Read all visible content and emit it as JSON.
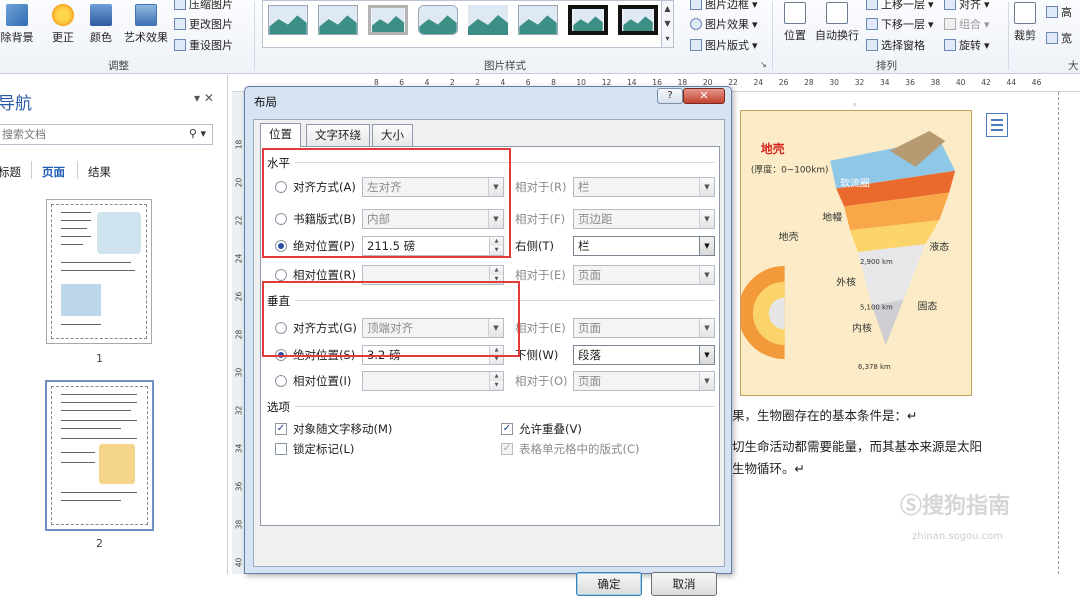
{
  "ribbon": {
    "adjust": {
      "remove_bg": "除背景",
      "corrections": "更正",
      "color": "颜色",
      "artistic": "艺术效果",
      "compress": "压缩图片",
      "change": "更改图片",
      "reset": "重设图片",
      "group_label": "调整"
    },
    "styles": {
      "group_label": "图片样式",
      "border": "图片边框",
      "effects": "图片效果",
      "layout": "图片版式"
    },
    "arrange": {
      "position": "位置",
      "wrap": "自动换行",
      "bring_forward": "上移一层",
      "send_backward": "下移一层",
      "selection_pane": "选择窗格",
      "align": "对齐",
      "group": "组合",
      "rotate": "旋转",
      "group_label": "排列"
    },
    "size": {
      "crop": "裁剪",
      "height": "高",
      "width": "宽",
      "group_label": "大"
    }
  },
  "nav": {
    "title": "导航",
    "search_placeholder": "搜索文档",
    "tabs": [
      "标题",
      "页面",
      "结果"
    ],
    "pages": [
      "1",
      "2"
    ]
  },
  "ruler": {
    "h": [
      "8",
      "6",
      "4",
      "2",
      "2",
      "4",
      "6",
      "8",
      "10",
      "12",
      "14",
      "16",
      "18",
      "20",
      "22",
      "24",
      "26",
      "28",
      "30",
      "32",
      "34",
      "36",
      "38",
      "40",
      "42",
      "44",
      "46"
    ],
    "v": [
      "18",
      "20",
      "22",
      "24",
      "26",
      "28",
      "30",
      "32",
      "34",
      "36",
      "38",
      "40"
    ]
  },
  "doc": {
    "line1": "果，生物圈存在的基本条件是：↵",
    "line2": "切生命活动都需要能量，而其基本来源是太阳",
    "line3": "生物循环。↵",
    "figure": {
      "crust_title": "地壳",
      "crust_thickness": "(厚度：0~100km)",
      "asthenosphere": "软流圈",
      "mantle": "地幔",
      "crust": "地壳",
      "outer_core": "外核",
      "liquid": "液态",
      "inner_core": "内核",
      "solid": "固态",
      "d1": "2,900 km",
      "d2": "5,100 km",
      "d3": "6,378 km"
    }
  },
  "dialog": {
    "title": "布局",
    "help": "?",
    "close": "✕",
    "tabs": [
      "位置",
      "文字环绕",
      "大小"
    ],
    "horizontal": {
      "title": "水平",
      "rows": [
        {
          "label": "对齐方式(A)",
          "value": "左对齐",
          "rel_label": "相对于(R)",
          "rel_value": "栏"
        },
        {
          "label": "书籍版式(B)",
          "value": "内部",
          "rel_label": "相对于(F)",
          "rel_value": "页边距"
        },
        {
          "label": "绝对位置(P)",
          "value": "211.5 磅",
          "rel_label": "右侧(T)",
          "rel_value": "栏"
        },
        {
          "label": "相对位置(R)",
          "value": "",
          "rel_label": "相对于(E)",
          "rel_value": "页面"
        }
      ]
    },
    "vertical": {
      "title": "垂直",
      "rows": [
        {
          "label": "对齐方式(G)",
          "value": "顶端对齐",
          "rel_label": "相对于(E)",
          "rel_value": "页面"
        },
        {
          "label": "绝对位置(S)",
          "value": "3.2 磅",
          "rel_label": "下侧(W)",
          "rel_value": "段落"
        },
        {
          "label": "相对位置(I)",
          "value": "",
          "rel_label": "相对于(O)",
          "rel_value": "页面"
        }
      ]
    },
    "options": {
      "title": "选项",
      "move_with_text": "对象随文字移动(M)",
      "lock_anchor": "锁定标记(L)",
      "allow_overlap": "允许重叠(V)",
      "table_cell": "表格单元格中的版式(C)"
    },
    "ok": "确定",
    "cancel": "取消"
  },
  "watermark": {
    "main": "搜狗指南",
    "sub": "zhinan.sogou.com"
  }
}
